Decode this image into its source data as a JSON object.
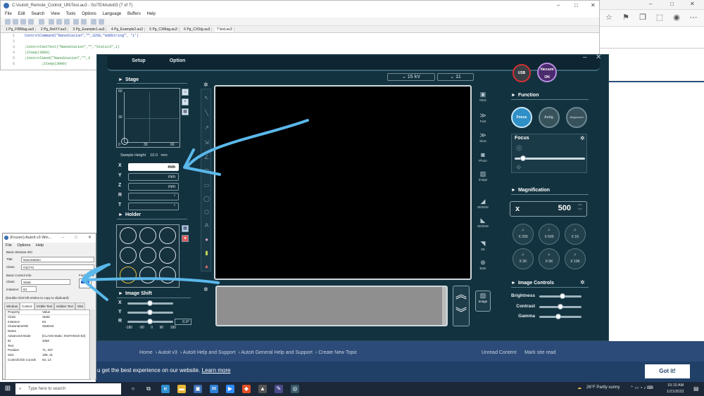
{
  "editor": {
    "title": "C:\\AutoIt_Remote_Control_UN\\Test.au3 - SciTE4AutoIt3 (7 of 7)",
    "menu": [
      "File",
      "Edit",
      "Search",
      "View",
      "Tools",
      "Options",
      "Language",
      "Buffers",
      "Help"
    ],
    "tabs": [
      "1 Pg_FIBMag.au3",
      "2 Pg_RelXY.au3",
      "3 Pg_Example1.au3",
      "4 Pg_Example2.au3",
      "5 Pg_CXMag.au3",
      "6 Pg_CXStg.au3",
      "7 test.au3"
    ],
    "lines": [
      {
        "n": "1",
        "code": "ControlCommand(\"NanoStation\",\"\",3250,\"AddString\", '1')"
      },
      {
        "n": "2",
        "code": ""
      },
      {
        "n": "3",
        "code": ";ControlSetText(\"NanoStation\",\"\",\"Static3\",1)"
      },
      {
        "n": "4",
        "code": ";Sleep(3000)"
      },
      {
        "n": "5",
        "code": ";ControlSend(\"NanoStation\",\"\",3"
      },
      {
        "n": "6",
        "code": "        ;Sleep(3000)"
      }
    ]
  },
  "app": {
    "setup_label": "Setup",
    "option_label": "Option",
    "kv": "15 kV",
    "spot": "11",
    "usb_label": "USB",
    "vacuum_label": "Vacuum ON",
    "stage": {
      "title": "Stage",
      "y_ticks": [
        "60",
        "30",
        "0"
      ],
      "x_ticks": [
        "30",
        "60"
      ],
      "sample_height_label": "Sample Height",
      "sample_height_value": "10.0",
      "sample_height_unit": "mm",
      "axes": [
        {
          "label": "X",
          "unit": "mm"
        },
        {
          "label": "Y",
          "unit": "mm"
        },
        {
          "label": "Z",
          "unit": "mm"
        },
        {
          "label": "R",
          "unit": "°"
        },
        {
          "label": "T",
          "unit": "°"
        }
      ]
    },
    "holder_title": "Holder",
    "image_shift": {
      "title": "Image Shift",
      "rows": [
        "X",
        "Y",
        "R"
      ],
      "scale": [
        "-180",
        "-90",
        "0",
        "90",
        "180"
      ],
      "r_value": "0.0°"
    },
    "modes": [
      "RED",
      "Fast",
      "Slow",
      "Photo",
      "Image",
      "SE/BSE",
      "SE/BSE",
      "SE",
      "BSE",
      "Image"
    ],
    "function": {
      "title": "Function",
      "buttons": [
        "Focus",
        "Astig.",
        "Alignment"
      ],
      "focus_title": "Focus"
    },
    "magnification": {
      "title": "Magnification",
      "prefix": "x",
      "value": "500",
      "presets": [
        "X 200",
        "X 500",
        "X 1K",
        "X 2K",
        "X 5K",
        "X 10K"
      ]
    },
    "image_controls": {
      "title": "Image Controls",
      "items": [
        {
          "label": "Brightness",
          "level": 0.55
        },
        {
          "label": "Contrast",
          "level": 0.5
        },
        {
          "label": "Gamma",
          "level": 0.45
        }
      ]
    }
  },
  "autoit": {
    "title": "(Frozen) AutoIt v3 Win...",
    "menu": [
      "File",
      "Options",
      "Help"
    ],
    "basic_window_label": "Basic Window Info",
    "title_label": "Title:",
    "title_value": "NanoStation",
    "class_label": "Class:",
    "class_value": "#32770",
    "basic_control_label": "Basic Control Info",
    "ctrl_class_label": "Class:",
    "ctrl_class_value": "Static",
    "instance_label": "Instance:",
    "instance_value": "63",
    "finder_label": "Finder Tool",
    "hint": "(Double-click left entries to copy to clipboard)",
    "tabs": [
      "Window",
      "Control",
      "Visible Text",
      "Hidden Text",
      "Stat"
    ],
    "table_header": {
      "k": "Property",
      "v": "Value"
    },
    "rows": [
      {
        "k": "Class",
        "v": "Static"
      },
      {
        "k": "Instance",
        "v": "63"
      },
      {
        "k": "ClassnameNN",
        "v": "Static63"
      },
      {
        "k": "Name",
        "v": ""
      },
      {
        "k": "Advanced Mode",
        "v": "[CLASS:Static; INSTANCE:63]"
      },
      {
        "k": "ID",
        "v": "3250"
      },
      {
        "k": "Text",
        "v": ""
      },
      {
        "k": "Position",
        "v": "71, 337"
      },
      {
        "k": "Size",
        "v": "188, 31"
      },
      {
        "k": "ControlClick Coords",
        "v": "94, 13"
      }
    ]
  },
  "web": {
    "breadcrumbs": [
      "Home",
      "Autoit v3",
      "AutoIt Help and Support",
      "AutoIt General Help and Support",
      "Create New Topic"
    ],
    "unread": "Unread Content",
    "mark_read": "Mark site read",
    "cookie_text": "u get the best experience on our website.",
    "learn_more": "Learn more",
    "got_it": "Got it!"
  },
  "taskbar": {
    "search_placeholder": "Type here to search",
    "weather": "26°F  Partly sunny",
    "time": "10:10 AM",
    "date": "1/21/2022"
  },
  "colors": {
    "app_bg": "#13323f",
    "annotation": "#5ab8ea",
    "web_band": "#2c4b78"
  }
}
